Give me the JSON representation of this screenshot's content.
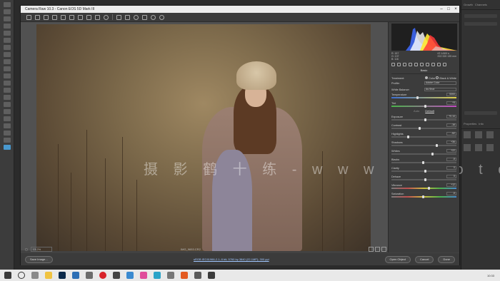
{
  "dialog": {
    "title": "Camera Raw 10.3  -  Canon EOS 5D Mark III"
  },
  "right_panel": {
    "tab_growth": "Growth",
    "tab_channels": "Channels",
    "tab_properties": "Properties",
    "tab_info": "Info"
  },
  "histogram": {
    "readout": {
      "r": "R:   157",
      "g": "G:   137",
      "b": "B:   116",
      "exposure": "f/2    1/400 s",
      "iso": "ISO 320   135 mm"
    }
  },
  "basic": {
    "section_title": "Basic",
    "treatment_label": "Treatment:",
    "treatment_color": "Color",
    "treatment_bw": "Black & White",
    "profile_label": "Profile:",
    "profile_value": "Adobe Color",
    "wb_label": "White Balance:",
    "wb_value": "As Shot",
    "auto_label": "Auto",
    "default_label": "Default",
    "sliders": [
      {
        "label": "Temperature",
        "value": "5300"
      },
      {
        "label": "Tint",
        "value": "+5"
      },
      {
        "label": "Exposure",
        "value": "+0.14"
      },
      {
        "label": "Contrast",
        "value": "-16"
      },
      {
        "label": "Highlights",
        "value": "-52"
      },
      {
        "label": "Shadows",
        "value": "+36"
      },
      {
        "label": "Whites",
        "value": "+22"
      },
      {
        "label": "Blacks",
        "value": "-5"
      },
      {
        "label": "Clarity",
        "value": "0"
      },
      {
        "label": "Dehaze",
        "value": "0"
      },
      {
        "label": "Vibrance",
        "value": "+12"
      },
      {
        "label": "Saturation",
        "value": "-5"
      }
    ]
  },
  "viewer": {
    "zoom": "13.2%",
    "filename": "IMG_9653.CR2",
    "watermark": "摄 影 鹤 十 练 - w w w . p h o t o s k s . v i p"
  },
  "footer": {
    "save_image": "Save Image...",
    "workflow": "sRGB IEC61966-2.1; 8 bit; 5760 by 3840 (22.1MP); 300 ppi",
    "open_object": "Open Object",
    "cancel": "Cancel",
    "done": "Done"
  },
  "taskbar": {
    "clock": "10:33"
  },
  "colors": {
    "dialog_bg": "#424242",
    "link": "#9fc6ff",
    "photo_tone": "#7d6a4b"
  }
}
